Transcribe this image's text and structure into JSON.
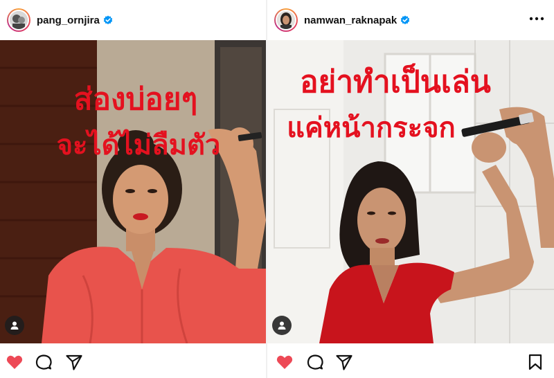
{
  "posts": [
    {
      "username": "pang_ornjira",
      "verified": true,
      "caption_line1": "ส่องบ่อยๆ",
      "caption_line2": "จะได้ไม่ลืมตัว",
      "liked": true
    },
    {
      "username": "namwan_raknapak",
      "verified": true,
      "caption_line1": "อย่าทำเป็นเล่น",
      "caption_line2": "แค่หน้ากระจก",
      "liked": true
    }
  ],
  "colors": {
    "like_red": "#ed4956",
    "verified_blue": "#0095f6",
    "lipstick_red": "#e4111f",
    "jacket_red": "#e8534c",
    "dress_red": "#c8141c"
  }
}
